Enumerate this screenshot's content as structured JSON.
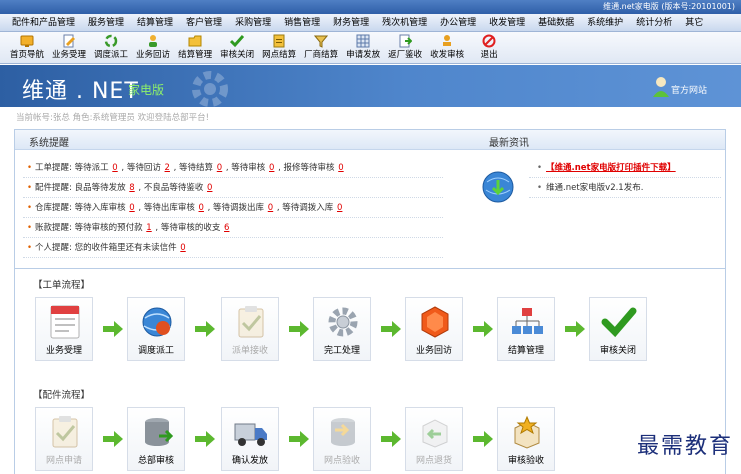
{
  "version_text": "维通.net家电版 (版本号:20101001)",
  "menu": [
    "配件和产品管理",
    "服务管理",
    "结算管理",
    "客户管理",
    "采购管理",
    "销售管理",
    "财务管理",
    "残次机管理",
    "办公管理",
    "收发管理",
    "基础数据",
    "系统维护",
    "统计分析",
    "其它"
  ],
  "toolbar": [
    {
      "label": "首页导航",
      "icon": "home-icon"
    },
    {
      "label": "业务受理",
      "icon": "edit-icon"
    },
    {
      "label": "调度派工",
      "icon": "recycle-icon"
    },
    {
      "label": "业务回访",
      "icon": "person-icon"
    },
    {
      "label": "结算管理",
      "icon": "folder-icon"
    },
    {
      "label": "审核关闭",
      "icon": "check-icon"
    },
    {
      "label": "网点结算",
      "icon": "document-icon"
    },
    {
      "label": "厂商结算",
      "icon": "funnel-icon"
    },
    {
      "label": "申请发放",
      "icon": "grid-icon"
    },
    {
      "label": "返厂鉴收",
      "icon": "export-icon"
    },
    {
      "label": "收发审核",
      "icon": "stamp-icon"
    },
    {
      "label": "退出",
      "icon": "exit-icon"
    }
  ],
  "banner": {
    "logo": "维通 . NET",
    "sub": "家电版",
    "portal": "官方网站"
  },
  "user_line": "当前帐号:张总   角色:系统管理员   欢迎登陆总部平台!",
  "system_alerts": {
    "title": "系统提醒",
    "rows": [
      [
        {
          "t": "工单提醒: 等待派工 "
        },
        {
          "n": "0"
        },
        {
          "t": " ,   等待回访 "
        },
        {
          "n": "2"
        },
        {
          "t": " ,   等待结算 "
        },
        {
          "n": "0"
        },
        {
          "t": " ,   等待审核 "
        },
        {
          "n": "0"
        },
        {
          "t": " ,   报修等待审核 "
        },
        {
          "n": "0"
        }
      ],
      [
        {
          "t": "配件提醒: 良品等待发放 "
        },
        {
          "n": "8"
        },
        {
          "t": " ,   不良品等待鉴收 "
        },
        {
          "n": "0"
        }
      ],
      [
        {
          "t": "仓库提醒: 等待入库审核 "
        },
        {
          "n": "0"
        },
        {
          "t": " ,   等待出库审核 "
        },
        {
          "n": "0"
        },
        {
          "t": " ,   等待调拨出库 "
        },
        {
          "n": "0"
        },
        {
          "t": " ,   等待调拨入库 "
        },
        {
          "n": "0"
        }
      ],
      [
        {
          "t": "账款提醒: 等待审核的预付款 "
        },
        {
          "n": "1"
        },
        {
          "t": " ,   等待审核的收支 "
        },
        {
          "n": "6"
        }
      ],
      [
        {
          "t": "个人提醒: 您的收件箱里还有未读信件 "
        },
        {
          "n": "0"
        }
      ]
    ]
  },
  "news": {
    "title": "最新资讯",
    "items": [
      {
        "text": "【维通.net家电版打印插件下载】",
        "hot": true
      },
      {
        "text": "维通.net家电版v2.1发布.",
        "hot": false
      }
    ]
  },
  "work_flow": {
    "title": "【工单流程】",
    "items": [
      {
        "label": "业务受理",
        "icon": "form-icon",
        "enabled": true
      },
      {
        "label": "调度派工",
        "icon": "globe-icon",
        "enabled": true
      },
      {
        "label": "派单接收",
        "icon": "clipboard-icon",
        "enabled": false
      },
      {
        "label": "完工处理",
        "icon": "gear-icon",
        "enabled": true
      },
      {
        "label": "业务回访",
        "icon": "hexagon-icon",
        "enabled": true
      },
      {
        "label": "结算管理",
        "icon": "org-chart-icon",
        "enabled": true
      },
      {
        "label": "审核关闭",
        "icon": "checkmark-icon",
        "enabled": true
      }
    ]
  },
  "parts_flow": {
    "title": "【配件流程】",
    "items": [
      {
        "label": "网点申请",
        "icon": "clipboard-icon",
        "enabled": false
      },
      {
        "label": "总部审核",
        "icon": "database-icon",
        "enabled": true
      },
      {
        "label": "确认发放",
        "icon": "truck-icon",
        "enabled": true
      },
      {
        "label": "网点验收",
        "icon": "database-arrow-icon",
        "enabled": false
      },
      {
        "label": "网点退货",
        "icon": "box-return-icon",
        "enabled": false
      },
      {
        "label": "审核验收",
        "icon": "box-star-icon",
        "enabled": true
      }
    ]
  },
  "watermark": "最需教育",
  "colors": {
    "accent": "#2d5fa3",
    "alert_number": "#e00000",
    "arrow": "#5cb82f"
  }
}
